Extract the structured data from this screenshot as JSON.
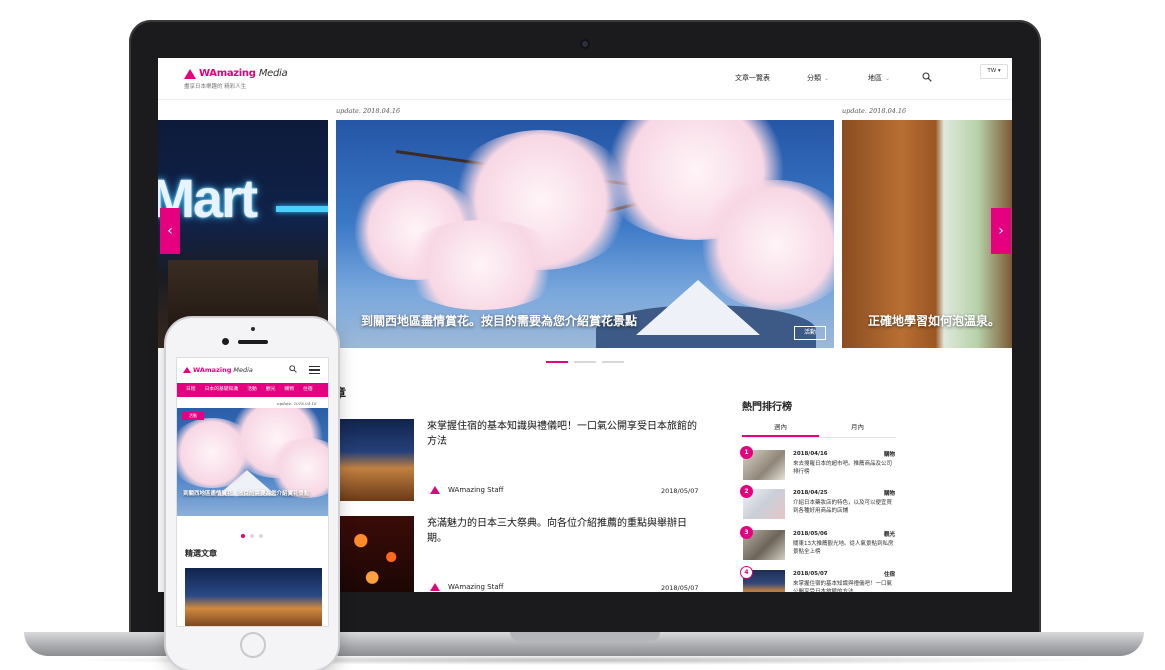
{
  "header": {
    "logo_brand": "WAmazing",
    "logo_media": "Media",
    "tagline": "盡享日本樂趣的 精彩人生",
    "nav": [
      {
        "label": "文章一覽表",
        "has_chevron": false
      },
      {
        "label": "分類",
        "has_chevron": true
      },
      {
        "label": "地區",
        "has_chevron": true
      }
    ],
    "lang": "TW ▾",
    "chevron_glyph": "⌄"
  },
  "carousel": {
    "slides": [
      {
        "update": "update. 2018.04.16",
        "caption": "到關西地區盡情賞花。按目的需要為您介紹賞花景點",
        "tag": "活動"
      },
      {
        "update": "update. 2018.04.16",
        "caption": "正確地學習如何泡溫泉。"
      }
    ],
    "left_sign": "Mart",
    "prev_glyph": "‹",
    "next_glyph": "›"
  },
  "section_heading_partial": "章",
  "articles": [
    {
      "title": "來掌握住宿的基本知識與禮儀吧！一口氣公開享受日本旅館的方法",
      "author": "WAmazing Staff",
      "date": "2018/05/07"
    },
    {
      "title": "充滿魅力的日本三大祭典。向各位介紹推薦的重點與舉辦日期。",
      "author": "WAmazing Staff",
      "date": "2018/05/07"
    }
  ],
  "ranking": {
    "title": "熱門排行榜",
    "tabs": [
      "週內",
      "月內"
    ],
    "items": [
      {
        "num": "1",
        "date": "2018/04/16",
        "category": "購物",
        "text": "來去搜羅日本的超市吧。推薦商品及公司排行榜"
      },
      {
        "num": "2",
        "date": "2018/04/25",
        "category": "購物",
        "text": "介紹日本藥妝店的特色，以及可以便宜買到各種好用商品的店鋪"
      },
      {
        "num": "3",
        "date": "2018/05/06",
        "category": "觀光",
        "text": "關東13大推薦觀光地。從人氣景點到私房景點全上榜"
      },
      {
        "num": "4",
        "date": "2018/05/07",
        "category": "住宿",
        "text": "來掌握住宿的基本知識與禮儀吧！一口氣公開享受日本旅館的方法"
      }
    ]
  },
  "phone": {
    "logo_brand": "WAmazing",
    "logo_media": "Media",
    "categories": [
      "日程",
      "日本的基礎知識",
      "活動",
      "觀光",
      "購物",
      "住宿"
    ],
    "update": "update. 2018.04.16",
    "hero_tag": "活動",
    "hero_caption": "到關西地區盡情賞花。按目的需要為您介紹賞花景點",
    "featured_title": "精選文章"
  },
  "colors": {
    "accent": "#e4007f",
    "laptop_bezel": "#1b1b1d",
    "aluminum": "#a7a9ac"
  },
  "icons": [
    "search-icon",
    "menu-icon",
    "chevron-left-icon",
    "chevron-right-icon",
    "logo-icon"
  ]
}
